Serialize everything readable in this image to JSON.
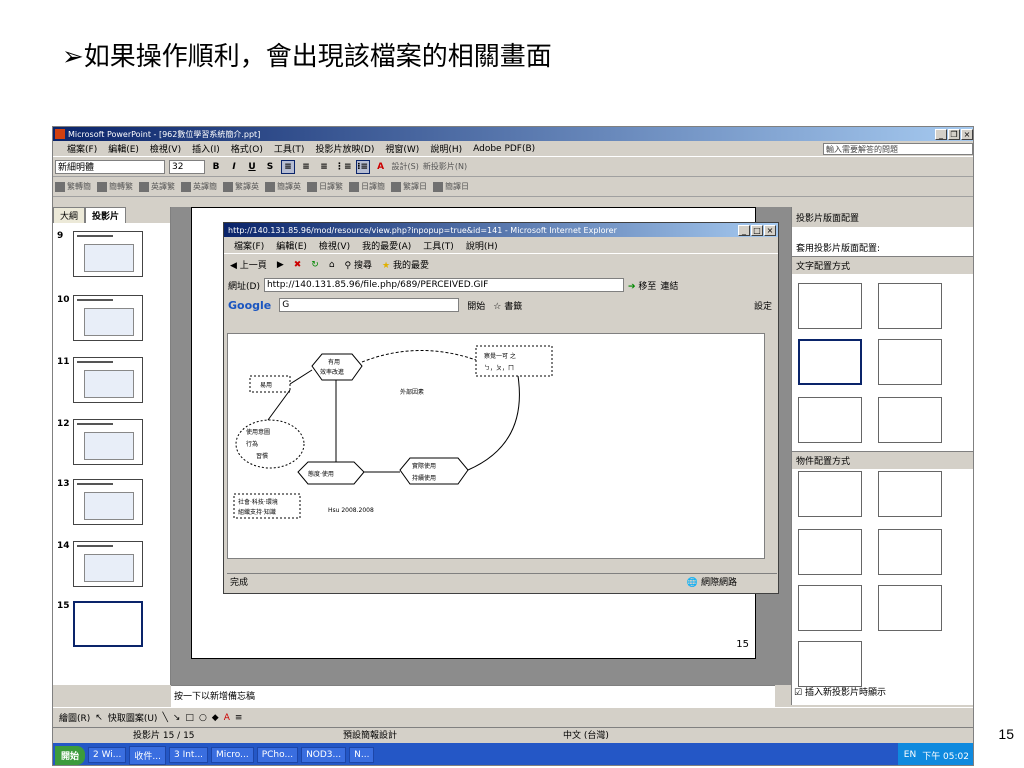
{
  "slide": {
    "title": "➢如果操作順利，會出現該檔案的相關畫面",
    "page_number": "15"
  },
  "ppt": {
    "window_title": "Microsoft PowerPoint - [962數位學習系統簡介.ppt]",
    "menu": [
      "檔案(F)",
      "編輯(E)",
      "檢視(V)",
      "插入(I)",
      "格式(O)",
      "工具(T)",
      "投影片放映(D)",
      "視窗(W)",
      "說明(H)",
      "Adobe PDF(B)"
    ],
    "help_placeholder": "輸入需要解答的問題",
    "font_name": "新細明體",
    "font_size": "32",
    "design_button": "設計(S)",
    "new_slide_button": "新投影片(N)",
    "convert_buttons": [
      "繁轉簡",
      "簡轉繁",
      "英譯繁",
      "英譯簡",
      "繁譯英",
      "簡譯英",
      "日譯繁",
      "日譯簡",
      "繁譯日",
      "簡譯日"
    ],
    "tabs": [
      "大綱",
      "投影片"
    ],
    "thumbnails": [
      "9",
      "10",
      "11",
      "12",
      "13",
      "14",
      "15"
    ],
    "notes_placeholder": "按一下以新增備忘稿",
    "slide_page_label": "15",
    "task_pane": {
      "title": "投影片版面配置",
      "apply_label": "套用投影片版面配置:",
      "text_layouts_label": "文字配置方式",
      "content_layouts_label": "物件配置方式",
      "show_on_insert": "插入新投影片時顯示"
    },
    "draw_label": "繪圖(R)",
    "autoshape_label": "快取圖案(U)",
    "status": {
      "slide_pos": "投影片 15 / 15",
      "design": "預設簡報設計",
      "language": "中文 (台灣)"
    }
  },
  "ie": {
    "title": "http://140.131.85.96/mod/resource/view.php?inpopup=true&id=141 - Microsoft Internet Explorer",
    "menu": [
      "檔案(F)",
      "編輯(E)",
      "檢視(V)",
      "我的最愛(A)",
      "工具(T)",
      "說明(H)"
    ],
    "back": "上一頁",
    "search": "搜尋",
    "favorites": "我的最愛",
    "address_label": "網址(D)",
    "address": "http://140.131.85.96/file.php/689/PERCEIVED.GIF",
    "go": "移至",
    "links": "連結",
    "google_start": "開始",
    "bookmarks": "書籤",
    "settings": "設定",
    "status_done": "完成",
    "status_zone": "網際網路",
    "diagram": {
      "top_right": [
        "察覺一可 之",
        "ㄅ，ㄆ，ㄇ"
      ],
      "node_a": [
        "易用"
      ],
      "node_b": [
        "有用",
        "效率改進"
      ],
      "arrow_label": "外部因素",
      "node_c": [
        "使用意圖",
        "行為",
        "習慣"
      ],
      "node_d": [
        "態度‧使用"
      ],
      "node_e": [
        "實際使用",
        "持續使用"
      ],
      "node_f": [
        "社會‧科技‧環境",
        "組織支持‧知識"
      ],
      "caption": "Hsu 2008.2008"
    }
  },
  "taskbar": {
    "start": "開始",
    "tasks": [
      "2 Wi...",
      "收件...",
      "3 Int...",
      "Micro...",
      "PCho...",
      "NOD3...",
      "N..."
    ],
    "lang": "EN",
    "clock": "下午 05:02"
  }
}
